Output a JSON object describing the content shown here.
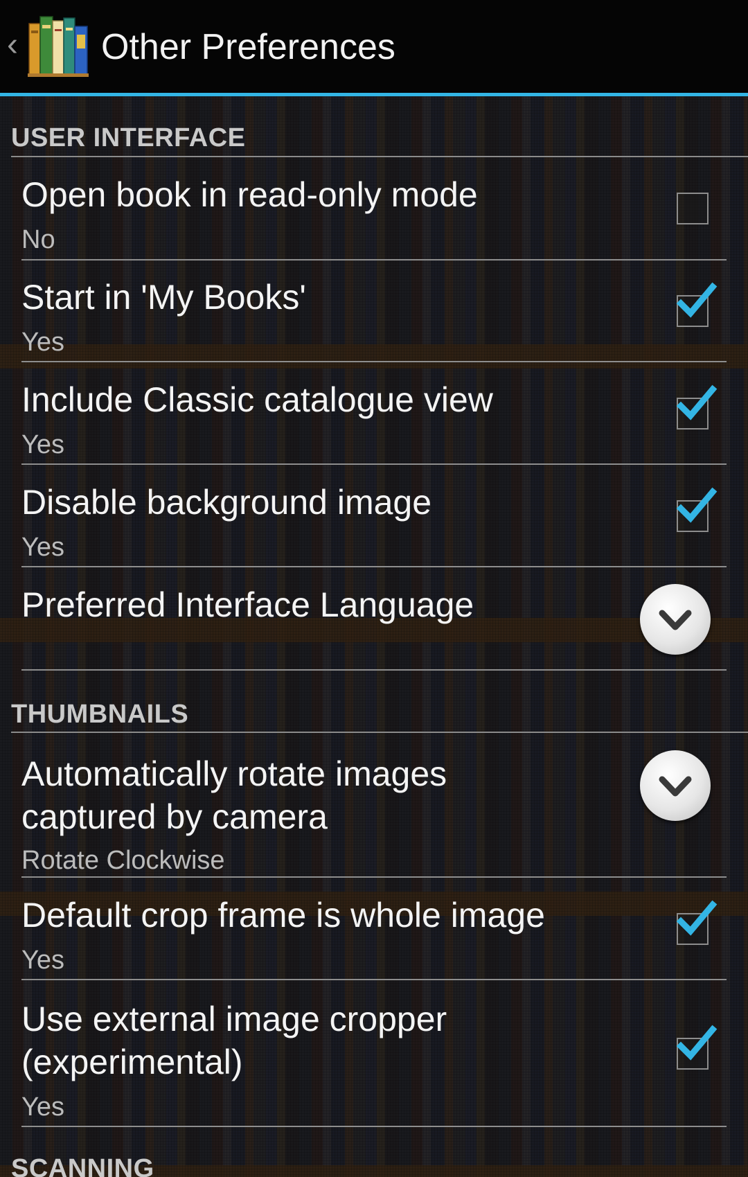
{
  "action_bar": {
    "title": "Other Preferences",
    "back_icon": "chevron-left-icon",
    "app_icon": "books-app-icon",
    "accent_color": "#33b5e5"
  },
  "sections": {
    "user_interface": {
      "header": "USER INTERFACE",
      "items": [
        {
          "title": "Open book in read-only mode",
          "summary": "No",
          "control": "checkbox",
          "checked": false
        },
        {
          "title": "Start in 'My Books'",
          "summary": "Yes",
          "control": "checkbox",
          "checked": true
        },
        {
          "title": "Include Classic catalogue view",
          "summary": "Yes",
          "control": "checkbox",
          "checked": true
        },
        {
          "title": "Disable background image",
          "summary": "Yes",
          "control": "checkbox",
          "checked": true
        },
        {
          "title": "Preferred Interface Language",
          "summary": "",
          "control": "dropdown"
        }
      ]
    },
    "thumbnails": {
      "header": "THUMBNAILS",
      "items": [
        {
          "title": "Automatically rotate images captured by camera",
          "summary": "Rotate Clockwise",
          "control": "dropdown"
        },
        {
          "title": "Default crop frame is whole image",
          "summary": "Yes",
          "control": "checkbox",
          "checked": true
        },
        {
          "title": "Use external image cropper (experimental)",
          "summary": "Yes",
          "control": "checkbox",
          "checked": true
        }
      ]
    },
    "scanning": {
      "header": "SCANNING"
    }
  }
}
